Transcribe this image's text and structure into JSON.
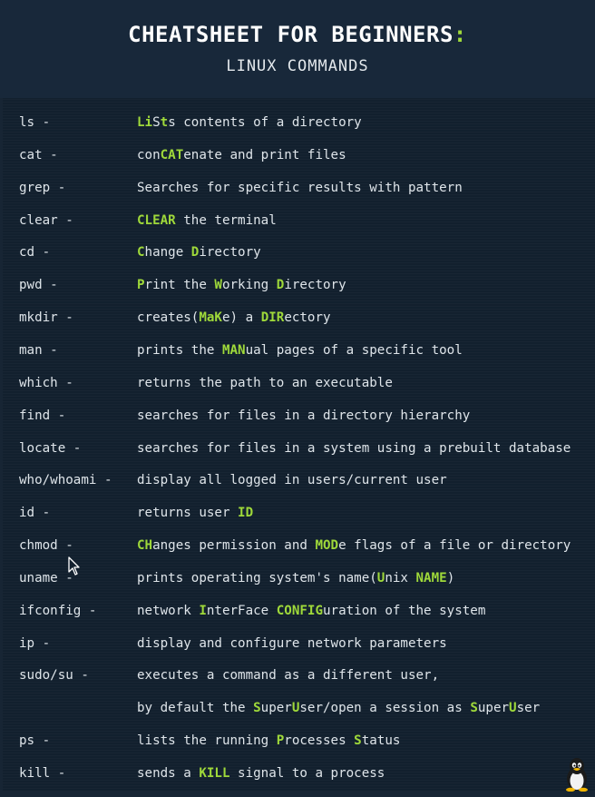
{
  "header": {
    "title": "CHEATSHEET FOR BEGINNERS",
    "title_colon": ":",
    "subtitle": "LINUX COMMANDS"
  },
  "colors": {
    "background": "#172534",
    "text": "#dfe5ea",
    "highlight": "#9fd93a"
  },
  "commands": [
    {
      "cmd": "ls -",
      "desc": [
        {
          "t": "Li",
          "h": true
        },
        {
          "t": "S",
          "h": false
        },
        {
          "t": "t",
          "h": true
        },
        {
          "t": "s contents of a directory",
          "h": false
        }
      ]
    },
    {
      "cmd": "cat -",
      "desc": [
        {
          "t": "con",
          "h": false
        },
        {
          "t": "CAT",
          "h": true
        },
        {
          "t": "enate and print files",
          "h": false
        }
      ]
    },
    {
      "cmd": "grep -",
      "desc": [
        {
          "t": "Searches for specific results with pattern",
          "h": false
        }
      ]
    },
    {
      "cmd": "clear -",
      "desc": [
        {
          "t": "CLEAR",
          "h": true
        },
        {
          "t": " the terminal",
          "h": false
        }
      ]
    },
    {
      "cmd": "cd -",
      "desc": [
        {
          "t": "C",
          "h": true
        },
        {
          "t": "hange ",
          "h": false
        },
        {
          "t": "D",
          "h": true
        },
        {
          "t": "irectory",
          "h": false
        }
      ]
    },
    {
      "cmd": "pwd -",
      "desc": [
        {
          "t": "P",
          "h": true
        },
        {
          "t": "rint the ",
          "h": false
        },
        {
          "t": "W",
          "h": true
        },
        {
          "t": "orking ",
          "h": false
        },
        {
          "t": "D",
          "h": true
        },
        {
          "t": "irectory",
          "h": false
        }
      ]
    },
    {
      "cmd": "mkdir -",
      "desc": [
        {
          "t": "creates(",
          "h": false
        },
        {
          "t": "MaK",
          "h": true
        },
        {
          "t": "e) a ",
          "h": false
        },
        {
          "t": "DIR",
          "h": true
        },
        {
          "t": "ectory",
          "h": false
        }
      ]
    },
    {
      "cmd": "man -",
      "desc": [
        {
          "t": "prints the ",
          "h": false
        },
        {
          "t": "MAN",
          "h": true
        },
        {
          "t": "ual pages of a specific tool",
          "h": false
        }
      ]
    },
    {
      "cmd": "which -",
      "desc": [
        {
          "t": "returns the path to an executable",
          "h": false
        }
      ]
    },
    {
      "cmd": "find -",
      "desc": [
        {
          "t": "searches for files in a directory hierarchy",
          "h": false
        }
      ]
    },
    {
      "cmd": "locate -",
      "desc": [
        {
          "t": "searches for files in a system using a prebuilt database",
          "h": false
        }
      ]
    },
    {
      "cmd": "who/whoami -",
      "desc": [
        {
          "t": "display all logged in users/current user",
          "h": false
        }
      ]
    },
    {
      "cmd": "id -",
      "desc": [
        {
          "t": "returns user ",
          "h": false
        },
        {
          "t": "ID",
          "h": true
        }
      ]
    },
    {
      "cmd": "chmod -",
      "desc": [
        {
          "t": "CH",
          "h": true
        },
        {
          "t": "anges permission and ",
          "h": false
        },
        {
          "t": "MOD",
          "h": true
        },
        {
          "t": "e flags of a file or directory",
          "h": false
        }
      ]
    },
    {
      "cmd": "uname -",
      "desc": [
        {
          "t": "prints operating system's name(",
          "h": false
        },
        {
          "t": "U",
          "h": true
        },
        {
          "t": "nix ",
          "h": false
        },
        {
          "t": "NAME",
          "h": true
        },
        {
          "t": ")",
          "h": false
        }
      ]
    },
    {
      "cmd": "ifconfig -",
      "desc": [
        {
          "t": "network ",
          "h": false
        },
        {
          "t": "I",
          "h": true
        },
        {
          "t": "nterFace ",
          "h": false
        },
        {
          "t": "CONFIG",
          "h": true
        },
        {
          "t": "uration of the system",
          "h": false
        }
      ]
    },
    {
      "cmd": "ip -",
      "desc": [
        {
          "t": "display and configure network parameters",
          "h": false
        }
      ]
    },
    {
      "cmd": "sudo/su -",
      "desc": [
        {
          "t": "executes a command as a different user,",
          "h": false
        }
      ]
    },
    {
      "cmd": "",
      "desc": [
        {
          "t": "by default the ",
          "h": false
        },
        {
          "t": "S",
          "h": true
        },
        {
          "t": "uper",
          "h": false
        },
        {
          "t": "U",
          "h": true
        },
        {
          "t": "ser/open a session as ",
          "h": false
        },
        {
          "t": "S",
          "h": true
        },
        {
          "t": "uper",
          "h": false
        },
        {
          "t": "U",
          "h": true
        },
        {
          "t": "ser",
          "h": false
        }
      ]
    },
    {
      "cmd": "ps -",
      "desc": [
        {
          "t": "lists the running ",
          "h": false
        },
        {
          "t": "P",
          "h": true
        },
        {
          "t": "rocesses ",
          "h": false
        },
        {
          "t": "S",
          "h": true
        },
        {
          "t": "tatus",
          "h": false
        }
      ]
    },
    {
      "cmd": "kill -",
      "desc": [
        {
          "t": "sends a ",
          "h": false
        },
        {
          "t": "KILL",
          "h": true
        },
        {
          "t": " signal to a process",
          "h": false
        }
      ]
    }
  ]
}
